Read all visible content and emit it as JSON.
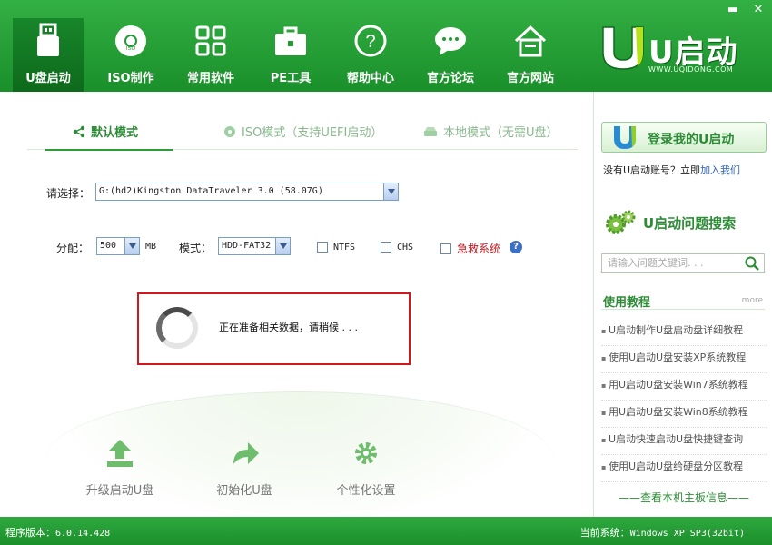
{
  "window": {
    "min_symbol": "▬",
    "close_symbol": "✕"
  },
  "nav": [
    {
      "label": "U盘启动",
      "icon": "usb-drive-icon"
    },
    {
      "label": "ISO制作",
      "icon": "disc-icon"
    },
    {
      "label": "常用软件",
      "icon": "grid-apps-icon"
    },
    {
      "label": "PE工具",
      "icon": "toolbox-icon"
    },
    {
      "label": "帮助中心",
      "icon": "question-icon"
    },
    {
      "label": "官方论坛",
      "icon": "chat-icon"
    },
    {
      "label": "官方网站",
      "icon": "home-icon"
    }
  ],
  "logo": {
    "brand": "U启动",
    "url": "WWW.UQIDONG.COM"
  },
  "modes": [
    {
      "label": "默认模式",
      "icon": "share-icon",
      "active": true
    },
    {
      "label": "ISO模式（支持UEFI启动）",
      "icon": "disc-icon",
      "active": false
    },
    {
      "label": "本地模式（无需U盘）",
      "icon": "drive-icon",
      "active": false
    }
  ],
  "form": {
    "select_label": "请选择：",
    "device_value": "G:(hd2)Kingston DataTraveler 3.0 (58.07G)",
    "alloc_label": "分配：",
    "alloc_value": "500",
    "alloc_unit": "MB",
    "mode_label": "模式：",
    "mode_value": "HDD-FAT32",
    "ntfs_label": "NTFS",
    "chs_label": "CHS",
    "rescue_label": "急救系统",
    "help_symbol": "?"
  },
  "loading": {
    "text": "正在准备相关数据，请稍候 . . ."
  },
  "tools": [
    {
      "label": "升级启动U盘",
      "icon": "upload-icon"
    },
    {
      "label": "初始化U盘",
      "icon": "redo-arrow-icon"
    },
    {
      "label": "个性化设置",
      "icon": "gear-icon"
    }
  ],
  "sidebar": {
    "login_label": "登录我的U启动",
    "register_prefix": "没有U启动账号？立即",
    "register_link": "加入我们",
    "search_title": "U启动问题搜索",
    "search_placeholder": "请输入问题关键词. . .",
    "tutorial_title": "使用教程",
    "more_label": "more",
    "tutorials": [
      "U启动制作U盘启动盘详细教程",
      "使用U启动U盘安装XP系统教程",
      "用U启动U盘安装Win7系统教程",
      "用U启动U盘安装Win8系统教程",
      "U启动快速启动U盘快捷键查询",
      "使用U启动U盘给硬盘分区教程"
    ],
    "footer_label": "——查看本机主板信息——"
  },
  "status": {
    "version_label": "程序版本：",
    "version_value": "6.0.14.428",
    "system_label": "当前系统：",
    "system_value": "Windows XP SP3(32bit)"
  },
  "colors": {
    "brand_green": "#1f9b30",
    "accent_green": "#2e8c37",
    "alert_red": "#d2181b"
  }
}
